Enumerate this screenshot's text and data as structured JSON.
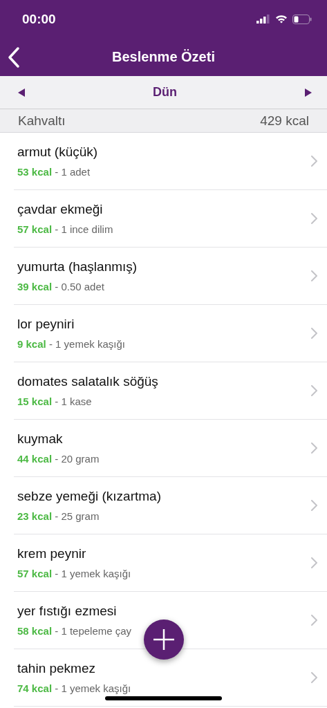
{
  "status_bar": {
    "time": "00:00"
  },
  "nav": {
    "title": "Beslenme Özeti"
  },
  "date_bar": {
    "label": "Dün"
  },
  "section": {
    "title": "Kahvaltı",
    "total": "429 kcal"
  },
  "items": [
    {
      "name": "armut (küçük)",
      "kcal": "53 kcal",
      "serving": "- 1 adet"
    },
    {
      "name": "çavdar ekmeği",
      "kcal": "57 kcal",
      "serving": "- 1 ince dilim"
    },
    {
      "name": "yumurta (haşlanmış)",
      "kcal": "39 kcal",
      "serving": "- 0.50 adet"
    },
    {
      "name": "lor peyniri",
      "kcal": "9 kcal",
      "serving": "- 1 yemek kaşığı"
    },
    {
      "name": "domates salatalık söğüş",
      "kcal": "15 kcal",
      "serving": "- 1 kase"
    },
    {
      "name": "kuymak",
      "kcal": "44 kcal",
      "serving": "- 20 gram"
    },
    {
      "name": "sebze yemeği (kızartma)",
      "kcal": "23 kcal",
      "serving": "- 25 gram"
    },
    {
      "name": "krem peynir",
      "kcal": "57 kcal",
      "serving": "- 1 yemek kaşığı"
    },
    {
      "name": "yer fıstığı ezmesi",
      "kcal": "58 kcal",
      "serving": "- 1 tepeleme çay"
    },
    {
      "name": "tahin pekmez",
      "kcal": "74 kcal",
      "serving": "- 1 yemek kaşığı"
    }
  ]
}
